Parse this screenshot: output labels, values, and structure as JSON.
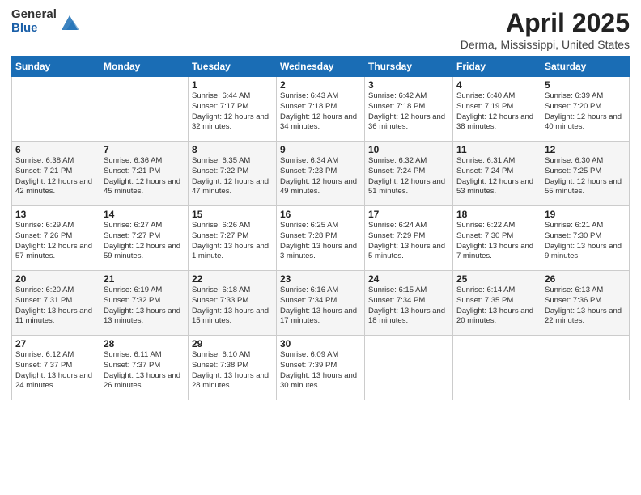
{
  "header": {
    "logo": {
      "general": "General",
      "blue": "Blue"
    },
    "title": "April 2025",
    "subtitle": "Derma, Mississippi, United States"
  },
  "weekdays": [
    "Sunday",
    "Monday",
    "Tuesday",
    "Wednesday",
    "Thursday",
    "Friday",
    "Saturday"
  ],
  "weeks": [
    [
      {
        "day": "",
        "info": ""
      },
      {
        "day": "",
        "info": ""
      },
      {
        "day": "1",
        "info": "Sunrise: 6:44 AM\nSunset: 7:17 PM\nDaylight: 12 hours\nand 32 minutes."
      },
      {
        "day": "2",
        "info": "Sunrise: 6:43 AM\nSunset: 7:18 PM\nDaylight: 12 hours\nand 34 minutes."
      },
      {
        "day": "3",
        "info": "Sunrise: 6:42 AM\nSunset: 7:18 PM\nDaylight: 12 hours\nand 36 minutes."
      },
      {
        "day": "4",
        "info": "Sunrise: 6:40 AM\nSunset: 7:19 PM\nDaylight: 12 hours\nand 38 minutes."
      },
      {
        "day": "5",
        "info": "Sunrise: 6:39 AM\nSunset: 7:20 PM\nDaylight: 12 hours\nand 40 minutes."
      }
    ],
    [
      {
        "day": "6",
        "info": "Sunrise: 6:38 AM\nSunset: 7:21 PM\nDaylight: 12 hours\nand 42 minutes."
      },
      {
        "day": "7",
        "info": "Sunrise: 6:36 AM\nSunset: 7:21 PM\nDaylight: 12 hours\nand 45 minutes."
      },
      {
        "day": "8",
        "info": "Sunrise: 6:35 AM\nSunset: 7:22 PM\nDaylight: 12 hours\nand 47 minutes."
      },
      {
        "day": "9",
        "info": "Sunrise: 6:34 AM\nSunset: 7:23 PM\nDaylight: 12 hours\nand 49 minutes."
      },
      {
        "day": "10",
        "info": "Sunrise: 6:32 AM\nSunset: 7:24 PM\nDaylight: 12 hours\nand 51 minutes."
      },
      {
        "day": "11",
        "info": "Sunrise: 6:31 AM\nSunset: 7:24 PM\nDaylight: 12 hours\nand 53 minutes."
      },
      {
        "day": "12",
        "info": "Sunrise: 6:30 AM\nSunset: 7:25 PM\nDaylight: 12 hours\nand 55 minutes."
      }
    ],
    [
      {
        "day": "13",
        "info": "Sunrise: 6:29 AM\nSunset: 7:26 PM\nDaylight: 12 hours\nand 57 minutes."
      },
      {
        "day": "14",
        "info": "Sunrise: 6:27 AM\nSunset: 7:27 PM\nDaylight: 12 hours\nand 59 minutes."
      },
      {
        "day": "15",
        "info": "Sunrise: 6:26 AM\nSunset: 7:27 PM\nDaylight: 13 hours\nand 1 minute."
      },
      {
        "day": "16",
        "info": "Sunrise: 6:25 AM\nSunset: 7:28 PM\nDaylight: 13 hours\nand 3 minutes."
      },
      {
        "day": "17",
        "info": "Sunrise: 6:24 AM\nSunset: 7:29 PM\nDaylight: 13 hours\nand 5 minutes."
      },
      {
        "day": "18",
        "info": "Sunrise: 6:22 AM\nSunset: 7:30 PM\nDaylight: 13 hours\nand 7 minutes."
      },
      {
        "day": "19",
        "info": "Sunrise: 6:21 AM\nSunset: 7:30 PM\nDaylight: 13 hours\nand 9 minutes."
      }
    ],
    [
      {
        "day": "20",
        "info": "Sunrise: 6:20 AM\nSunset: 7:31 PM\nDaylight: 13 hours\nand 11 minutes."
      },
      {
        "day": "21",
        "info": "Sunrise: 6:19 AM\nSunset: 7:32 PM\nDaylight: 13 hours\nand 13 minutes."
      },
      {
        "day": "22",
        "info": "Sunrise: 6:18 AM\nSunset: 7:33 PM\nDaylight: 13 hours\nand 15 minutes."
      },
      {
        "day": "23",
        "info": "Sunrise: 6:16 AM\nSunset: 7:34 PM\nDaylight: 13 hours\nand 17 minutes."
      },
      {
        "day": "24",
        "info": "Sunrise: 6:15 AM\nSunset: 7:34 PM\nDaylight: 13 hours\nand 18 minutes."
      },
      {
        "day": "25",
        "info": "Sunrise: 6:14 AM\nSunset: 7:35 PM\nDaylight: 13 hours\nand 20 minutes."
      },
      {
        "day": "26",
        "info": "Sunrise: 6:13 AM\nSunset: 7:36 PM\nDaylight: 13 hours\nand 22 minutes."
      }
    ],
    [
      {
        "day": "27",
        "info": "Sunrise: 6:12 AM\nSunset: 7:37 PM\nDaylight: 13 hours\nand 24 minutes."
      },
      {
        "day": "28",
        "info": "Sunrise: 6:11 AM\nSunset: 7:37 PM\nDaylight: 13 hours\nand 26 minutes."
      },
      {
        "day": "29",
        "info": "Sunrise: 6:10 AM\nSunset: 7:38 PM\nDaylight: 13 hours\nand 28 minutes."
      },
      {
        "day": "30",
        "info": "Sunrise: 6:09 AM\nSunset: 7:39 PM\nDaylight: 13 hours\nand 30 minutes."
      },
      {
        "day": "",
        "info": ""
      },
      {
        "day": "",
        "info": ""
      },
      {
        "day": "",
        "info": ""
      }
    ]
  ]
}
